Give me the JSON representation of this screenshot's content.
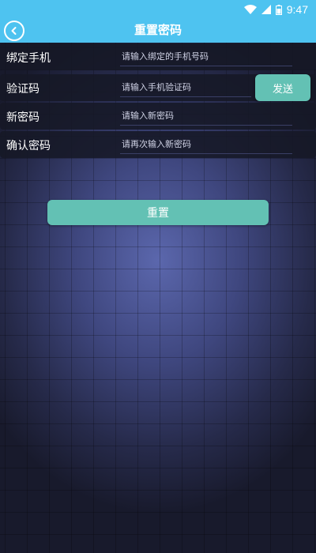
{
  "status_bar": {
    "time": "9:47",
    "icons": [
      "wifi-icon",
      "signal-icon",
      "battery-icon"
    ]
  },
  "app_bar": {
    "title": "重置密码",
    "back_icon": "chevron-left-icon"
  },
  "form": {
    "phone": {
      "label": "绑定手机",
      "placeholder": "请输入绑定的手机号码",
      "value": ""
    },
    "code": {
      "label": "验证码",
      "placeholder": "请输入手机验证码",
      "value": ""
    },
    "new_password": {
      "label": "新密码",
      "placeholder": "请输入新密码",
      "value": ""
    },
    "confirm_password": {
      "label": "确认密码",
      "placeholder": "请再次输入新密码",
      "value": ""
    }
  },
  "buttons": {
    "send": "发送",
    "reset": "重置"
  },
  "colors": {
    "header": "#4ec3f0",
    "button": "#63c1b4",
    "row_background": "#161826"
  }
}
